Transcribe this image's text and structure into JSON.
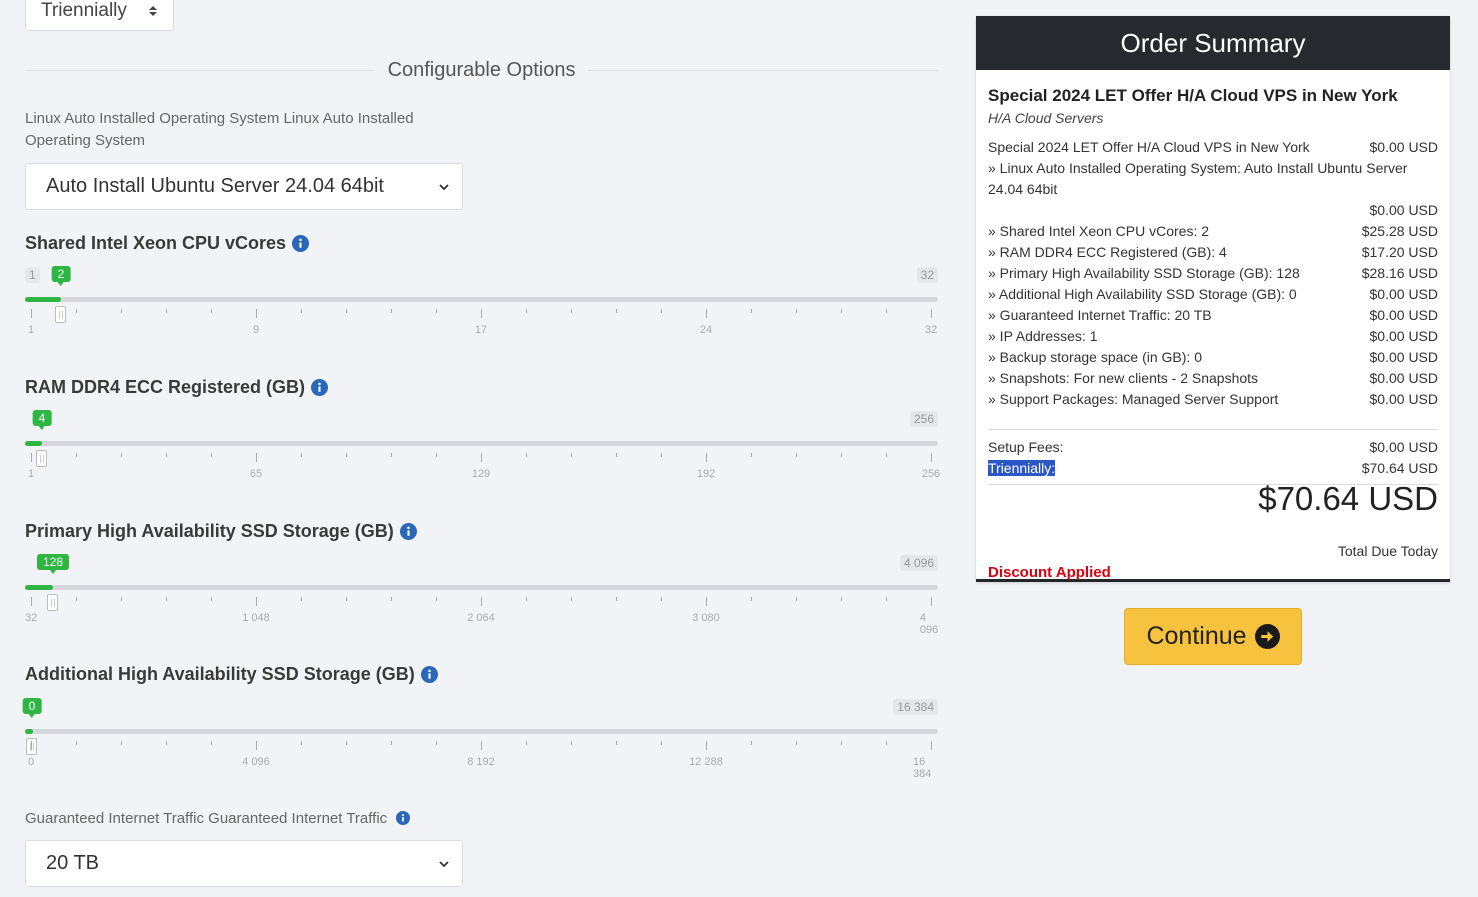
{
  "billing": {
    "selected": "Triennially"
  },
  "configurable": {
    "section_title": "Configurable Options",
    "os": {
      "label": "Linux Auto Installed Operating System Linux Auto Installed Operating System",
      "selected": "Auto Install Ubuntu Server 24.04 64bit"
    },
    "sliders": [
      {
        "title": "Shared Intel Xeon CPU vCores",
        "min": 1,
        "max": 32,
        "min_label": "1",
        "max_label": "32",
        "value": 2,
        "value_label": "2",
        "scale": [
          "1",
          "9",
          "17",
          "24",
          "32"
        ]
      },
      {
        "title": "RAM DDR4 ECC Registered (GB)",
        "min": 1,
        "max": 256,
        "min_label": "",
        "max_label": "256",
        "value": 4,
        "value_label": "4",
        "scale": [
          "1",
          "65",
          "129",
          "192",
          "256"
        ]
      },
      {
        "title": "Primary High Availability SSD Storage (GB)",
        "min": 32,
        "max": 4096,
        "min_label": "",
        "max_label": "4 096",
        "value": 128,
        "value_label": "128",
        "scale": [
          "32",
          "1 048",
          "2 064",
          "3 080",
          "4 096"
        ]
      },
      {
        "title": "Additional High Availability SSD Storage (GB)",
        "min": 0,
        "max": 16384,
        "min_label": "",
        "max_label": "16 384",
        "value": 0,
        "value_label": "0",
        "scale": [
          "0",
          "4 096",
          "8 192",
          "12 288",
          "16 384"
        ]
      }
    ],
    "traffic": {
      "label": "Guaranteed Internet Traffic Guaranteed Internet Traffic",
      "selected": "20 TB"
    }
  },
  "summary": {
    "title": "Order Summary",
    "product_name": "Special 2024 LET Offer H/A Cloud VPS in New York",
    "product_group": "H/A Cloud Servers",
    "items": [
      {
        "label": "Special 2024 LET Offer H/A Cloud VPS in New York",
        "price": "$0.00 USD"
      },
      {
        "label": " » Linux Auto Installed Operating System: Auto Install Ubuntu Server 24.04 64bit",
        "price": ""
      },
      {
        "label": "",
        "price": "$0.00 USD"
      },
      {
        "label": " » Shared Intel Xeon CPU vCores: 2",
        "price": "$25.28 USD"
      },
      {
        "label": " » RAM DDR4 ECC Registered (GB): 4",
        "price": "$17.20 USD"
      },
      {
        "label": " » Primary High Availability SSD Storage (GB): 128",
        "price": "$28.16 USD"
      },
      {
        "label": " » Additional High Availability SSD Storage (GB): 0",
        "price": "$0.00 USD"
      },
      {
        "label": " » Guaranteed Internet Traffic: 20 TB",
        "price": "$0.00 USD"
      },
      {
        "label": " » IP Addresses: 1",
        "price": "$0.00 USD"
      },
      {
        "label": " » Backup storage space (in GB): 0",
        "price": "$0.00 USD"
      },
      {
        "label": " » Snapshots: For new clients - 2 Snapshots",
        "price": "$0.00 USD"
      },
      {
        "label": " » Support Packages: Managed Server Support",
        "price": "$0.00 USD"
      }
    ],
    "setup_label": "Setup Fees:",
    "setup_price": "$0.00 USD",
    "cycle_label": "Triennially:",
    "cycle_price": "$70.64 USD",
    "total": "$70.64 USD",
    "total_label": "Total Due Today",
    "discount": "Discount Applied"
  },
  "continue_label": "Continue"
}
